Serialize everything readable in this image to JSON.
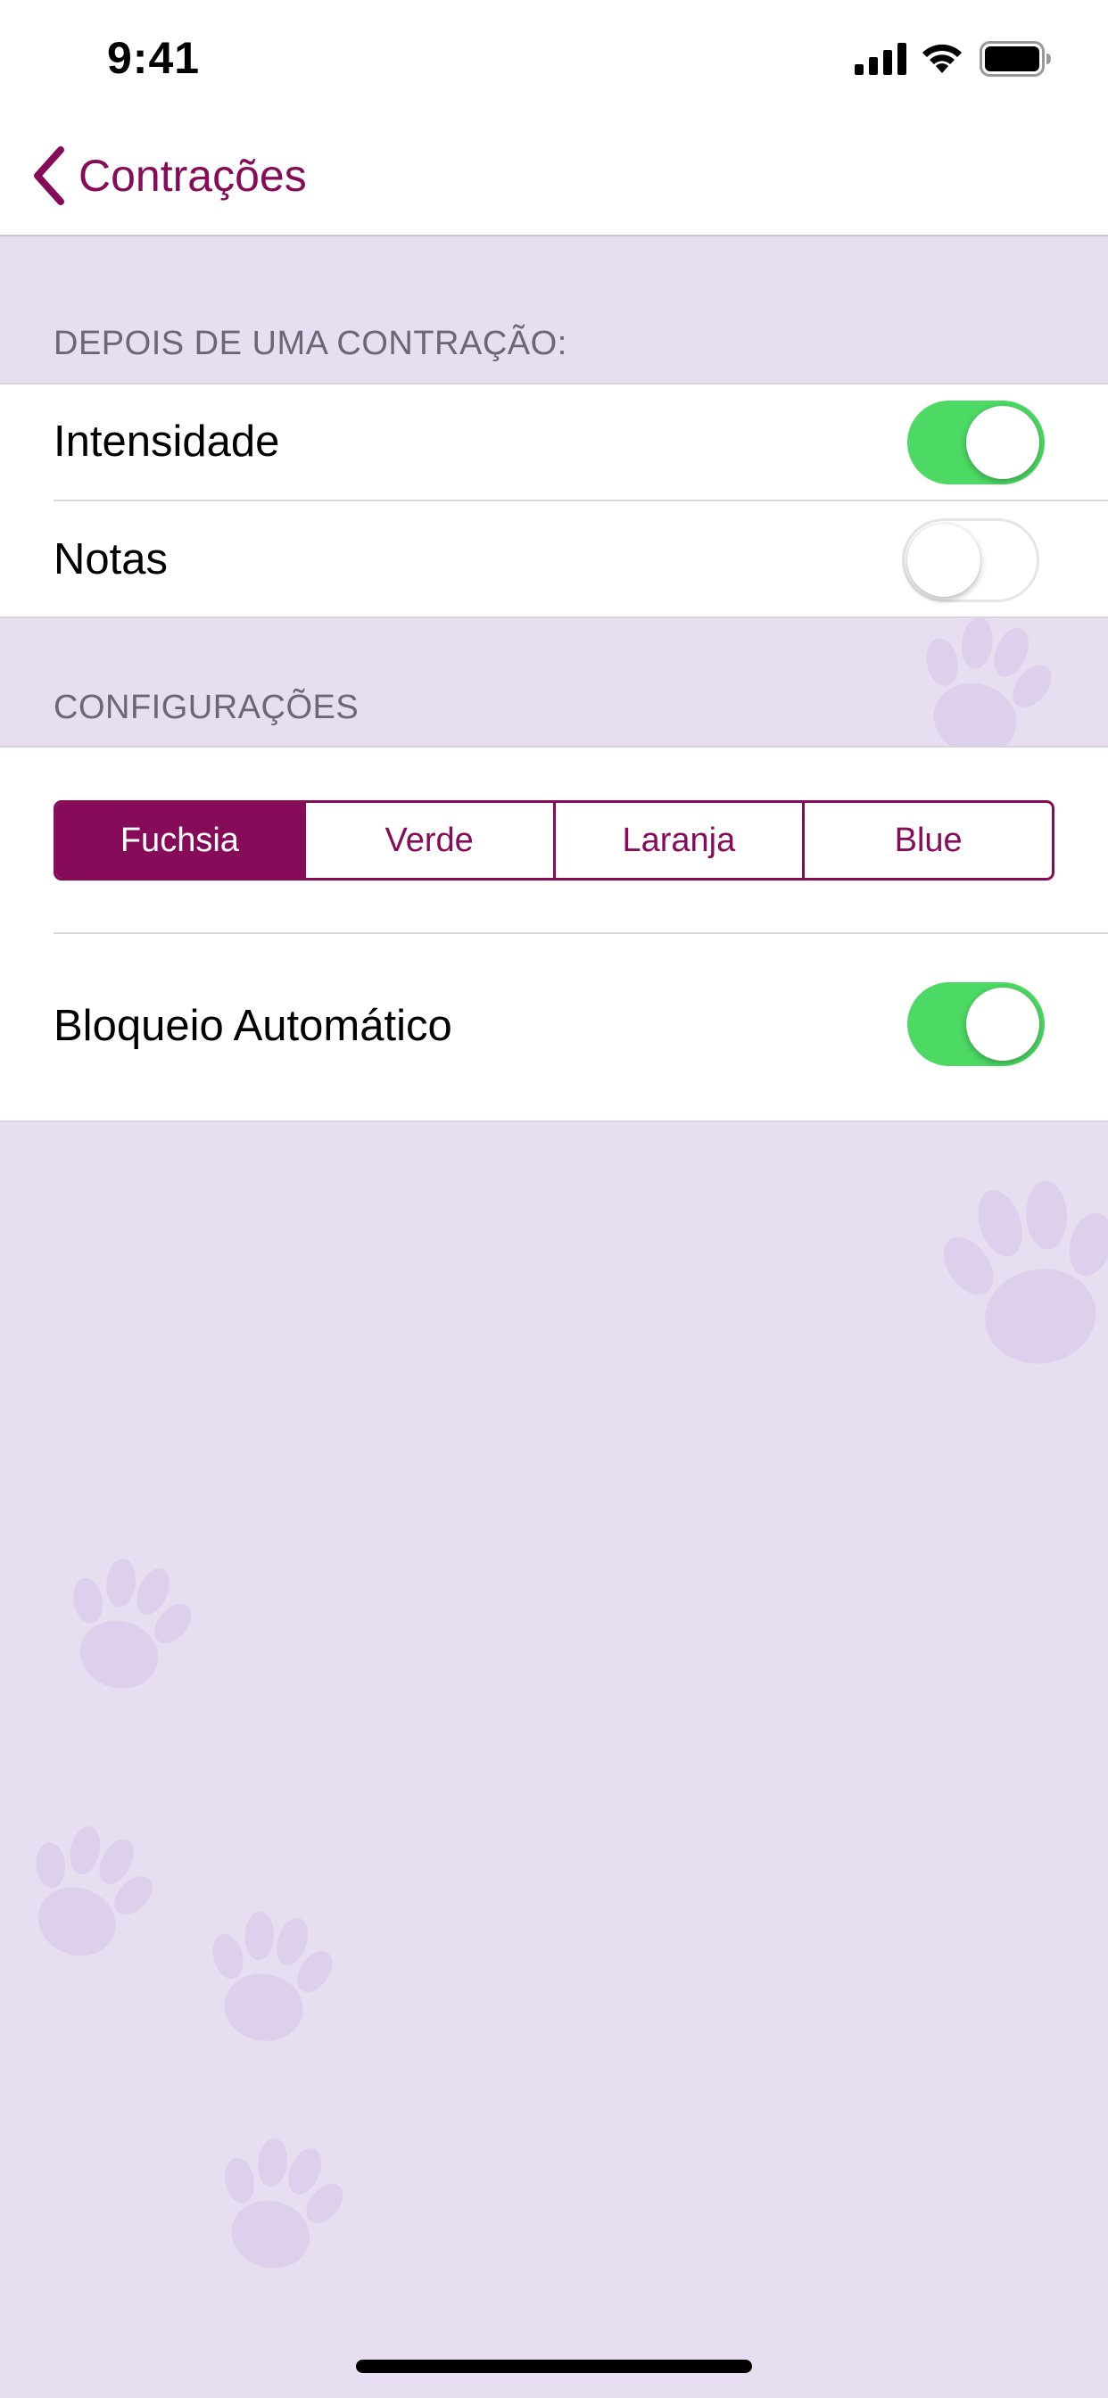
{
  "status_bar": {
    "time": "9:41"
  },
  "nav": {
    "back_label": "Contrações"
  },
  "section_after": {
    "header": "DEPOIS DE UMA CONTRAÇÃO:",
    "rows": [
      {
        "label": "Intensidade",
        "toggle": true
      },
      {
        "label": "Notas",
        "toggle": false
      }
    ]
  },
  "section_settings": {
    "header": "CONFIGURAÇÕES",
    "theme_segments": [
      "Fuchsia",
      "Verde",
      "Laranja",
      "Blue"
    ],
    "selected_theme": "Fuchsia",
    "auto_lock": {
      "label": "Bloqueio Automático",
      "toggle": true
    }
  },
  "colors": {
    "accent": "#860c5a",
    "switch_on": "#4cd964",
    "background": "#e7def2"
  }
}
